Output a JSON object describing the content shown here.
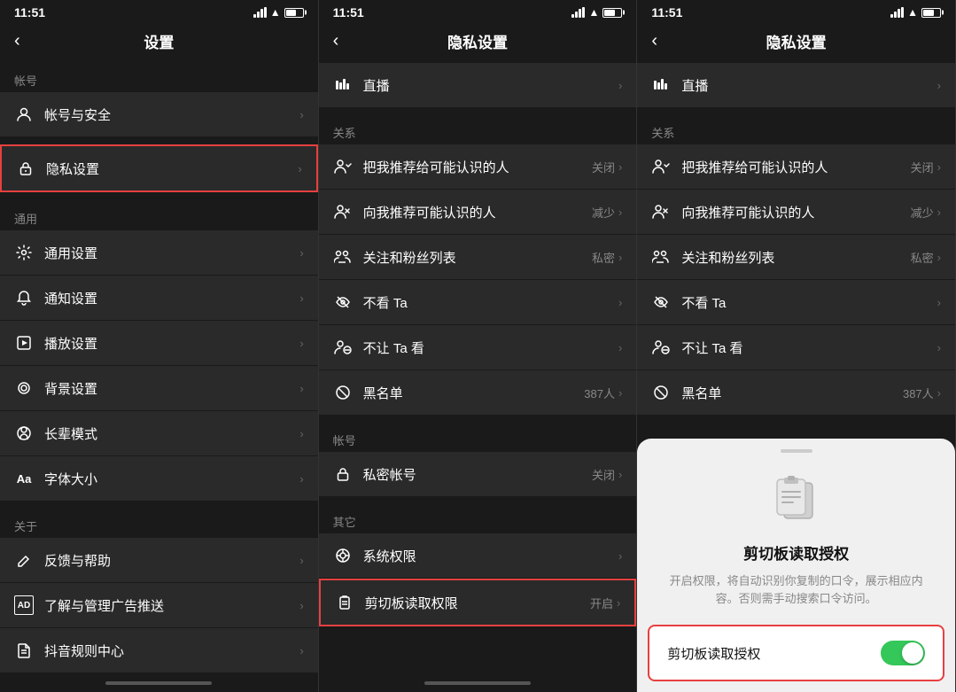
{
  "panel1": {
    "status": {
      "time": "11:51"
    },
    "header": {
      "back": "‹",
      "title": "设置"
    },
    "sections": [
      {
        "label": "帐号",
        "items": [
          {
            "icon": "person",
            "text": "帐号与安全",
            "right": "",
            "chevron": "›"
          }
        ]
      },
      {
        "label": "",
        "items": [
          {
            "icon": "lock",
            "text": "隐私设置",
            "right": "",
            "chevron": "›",
            "highlighted": true
          }
        ]
      },
      {
        "label": "通用",
        "items": [
          {
            "icon": "gear",
            "text": "通用设置",
            "right": "",
            "chevron": "›"
          },
          {
            "icon": "bell",
            "text": "通知设置",
            "right": "",
            "chevron": "›"
          },
          {
            "icon": "play",
            "text": "播放设置",
            "right": "",
            "chevron": "›"
          },
          {
            "icon": "bg",
            "text": "背景设置",
            "right": "",
            "chevron": "›"
          },
          {
            "icon": "elder",
            "text": "长辈模式",
            "right": "",
            "chevron": "›"
          },
          {
            "icon": "font",
            "text": "字体大小",
            "right": "",
            "chevron": "›"
          }
        ]
      },
      {
        "label": "关于",
        "items": [
          {
            "icon": "edit",
            "text": "反馈与帮助",
            "right": "",
            "chevron": "›"
          },
          {
            "icon": "ad",
            "text": "了解与管理广告推送",
            "right": "",
            "chevron": "›"
          },
          {
            "icon": "rules",
            "text": "抖音规则中心",
            "right": "",
            "chevron": "›"
          }
        ]
      }
    ]
  },
  "panel2": {
    "status": {
      "time": "11:51"
    },
    "header": {
      "back": "‹",
      "title": "隐私设置"
    },
    "sections": [
      {
        "label": "",
        "items": [
          {
            "icon": "live",
            "text": "直播",
            "right": "",
            "chevron": "›"
          }
        ]
      },
      {
        "label": "关系",
        "items": [
          {
            "icon": "recommend",
            "text": "把我推荐给可能认识的人",
            "right": "关闭",
            "chevron": "›"
          },
          {
            "icon": "recommend2",
            "text": "向我推荐可能认识的人",
            "right": "减少",
            "chevron": "›"
          },
          {
            "icon": "fans",
            "text": "关注和粉丝列表",
            "right": "私密",
            "chevron": "›"
          },
          {
            "icon": "nosee",
            "text": "不看 Ta",
            "right": "",
            "chevron": "›"
          },
          {
            "icon": "block",
            "text": "不让 Ta 看",
            "right": "",
            "chevron": "›"
          },
          {
            "icon": "blacklist",
            "text": "黑名单",
            "right": "387人",
            "chevron": "›"
          }
        ]
      },
      {
        "label": "帐号",
        "items": [
          {
            "icon": "lock2",
            "text": "私密帐号",
            "right": "关闭",
            "chevron": "›"
          }
        ]
      },
      {
        "label": "其它",
        "items": [
          {
            "icon": "sysperm",
            "text": "系统权限",
            "right": "",
            "chevron": "›"
          },
          {
            "icon": "clipboard",
            "text": "剪切板读取权限",
            "right": "开启",
            "chevron": "›",
            "highlighted": true
          }
        ]
      }
    ]
  },
  "panel3": {
    "status": {
      "time": "11:51"
    },
    "header": {
      "back": "‹",
      "title": "隐私设置"
    },
    "listSections": [
      {
        "label": "",
        "items": [
          {
            "icon": "live",
            "text": "直播",
            "right": "",
            "chevron": "›"
          }
        ]
      },
      {
        "label": "关系",
        "items": [
          {
            "icon": "recommend",
            "text": "把我推荐给可能认识的人",
            "right": "关闭",
            "chevron": "›"
          },
          {
            "icon": "recommend2",
            "text": "向我推荐可能认识的人",
            "right": "减少",
            "chevron": "›"
          },
          {
            "icon": "fans",
            "text": "关注和粉丝列表",
            "right": "私密",
            "chevron": "›"
          },
          {
            "icon": "nosee",
            "text": "不看 Ta",
            "right": "",
            "chevron": "›"
          },
          {
            "icon": "block",
            "text": "不让 Ta 看",
            "right": "",
            "chevron": "›"
          },
          {
            "icon": "blacklist",
            "text": "黑名单",
            "right": "387人",
            "chevron": "›"
          }
        ]
      }
    ],
    "modal": {
      "title": "剪切板读取授权",
      "desc": "开启权限，将自动识别你复制的口令，展示相应内容。否则需手动搜索口令访问。",
      "rowLabel": "剪切板读取授权",
      "toggleOn": true
    }
  },
  "icons": {
    "person": "○",
    "lock": "🔒",
    "gear": "⚙",
    "bell": "🔔",
    "play": "▶",
    "bg": "◎",
    "elder": "◉",
    "font": "Aa",
    "edit": "✎",
    "ad": "AD",
    "rules": "♪",
    "live": "📊",
    "recommend": "👥",
    "recommend2": "👤",
    "fans": "👥",
    "nosee": "👁",
    "block": "👤",
    "blacklist": "⊘",
    "lock2": "🔒",
    "sysperm": "◎",
    "clipboard": "📋"
  }
}
